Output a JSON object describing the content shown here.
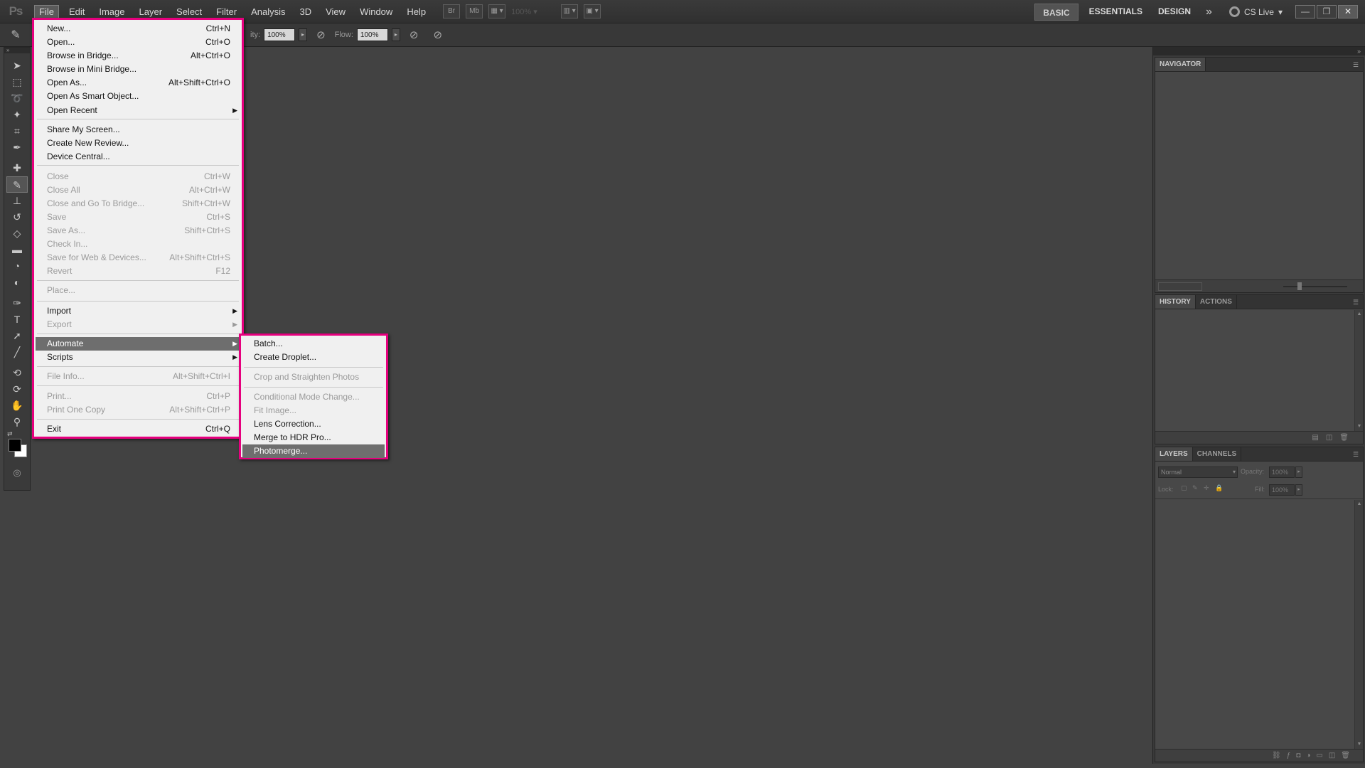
{
  "app": {
    "logo": "Ps"
  },
  "menubar": {
    "items": [
      "File",
      "Edit",
      "Image",
      "Layer",
      "Select",
      "Filter",
      "Analysis",
      "3D",
      "View",
      "Window",
      "Help"
    ],
    "bridge_btn": "Br",
    "minibridge_btn": "Mb",
    "zoom_value": "100%",
    "workspaces": [
      "BASIC",
      "ESSENTIALS",
      "DESIGN"
    ],
    "more": "»",
    "cs_live": "CS Live",
    "window_controls": {
      "minimize": "—",
      "restore": "❐",
      "close": "✕"
    }
  },
  "options": {
    "opacity_label": "ity:",
    "opacity_value": "100%",
    "flow_label": "Flow:",
    "flow_value": "100%"
  },
  "file_menu": {
    "items": [
      {
        "label": "New...",
        "shortcut": "Ctrl+N",
        "enabled": true
      },
      {
        "label": "Open...",
        "shortcut": "Ctrl+O",
        "enabled": true
      },
      {
        "label": "Browse in Bridge...",
        "shortcut": "Alt+Ctrl+O",
        "enabled": true
      },
      {
        "label": "Browse in Mini Bridge...",
        "shortcut": "",
        "enabled": true
      },
      {
        "label": "Open As...",
        "shortcut": "Alt+Shift+Ctrl+O",
        "enabled": true
      },
      {
        "label": "Open As Smart Object...",
        "shortcut": "",
        "enabled": true
      },
      {
        "label": "Open Recent",
        "shortcut": "",
        "enabled": true,
        "submenu": true
      },
      {
        "label": "Share My Screen...",
        "shortcut": "",
        "enabled": true
      },
      {
        "label": "Create New Review...",
        "shortcut": "",
        "enabled": true
      },
      {
        "label": "Device Central...",
        "shortcut": "",
        "enabled": true
      },
      {
        "label": "Close",
        "shortcut": "Ctrl+W",
        "enabled": false
      },
      {
        "label": "Close All",
        "shortcut": "Alt+Ctrl+W",
        "enabled": false
      },
      {
        "label": "Close and Go To Bridge...",
        "shortcut": "Shift+Ctrl+W",
        "enabled": false
      },
      {
        "label": "Save",
        "shortcut": "Ctrl+S",
        "enabled": false
      },
      {
        "label": "Save As...",
        "shortcut": "Shift+Ctrl+S",
        "enabled": false
      },
      {
        "label": "Check In...",
        "shortcut": "",
        "enabled": false
      },
      {
        "label": "Save for Web & Devices...",
        "shortcut": "Alt+Shift+Ctrl+S",
        "enabled": false
      },
      {
        "label": "Revert",
        "shortcut": "F12",
        "enabled": false
      },
      {
        "label": "Place...",
        "shortcut": "",
        "enabled": false
      },
      {
        "label": "Import",
        "shortcut": "",
        "enabled": true,
        "submenu": true
      },
      {
        "label": "Export",
        "shortcut": "",
        "enabled": false,
        "submenu": true
      },
      {
        "label": "Automate",
        "shortcut": "",
        "enabled": true,
        "submenu": true,
        "highlighted": true
      },
      {
        "label": "Scripts",
        "shortcut": "",
        "enabled": true,
        "submenu": true
      },
      {
        "label": "File Info...",
        "shortcut": "Alt+Shift+Ctrl+I",
        "enabled": false
      },
      {
        "label": "Print...",
        "shortcut": "Ctrl+P",
        "enabled": false
      },
      {
        "label": "Print One Copy",
        "shortcut": "Alt+Shift+Ctrl+P",
        "enabled": false
      },
      {
        "label": "Exit",
        "shortcut": "Ctrl+Q",
        "enabled": true
      }
    ]
  },
  "automate_menu": {
    "items": [
      {
        "label": "Batch...",
        "enabled": true
      },
      {
        "label": "Create Droplet...",
        "enabled": true
      },
      {
        "label": "Crop and Straighten Photos",
        "enabled": false
      },
      {
        "label": "Conditional Mode Change...",
        "enabled": false
      },
      {
        "label": "Fit Image...",
        "enabled": false
      },
      {
        "label": "Lens Correction...",
        "enabled": true
      },
      {
        "label": "Merge to HDR Pro...",
        "enabled": true
      },
      {
        "label": "Photomerge...",
        "enabled": true,
        "highlighted": true
      }
    ]
  },
  "panels": {
    "navigator": {
      "tabs": [
        "NAVIGATOR"
      ]
    },
    "history": {
      "tabs": [
        "HISTORY",
        "ACTIONS"
      ]
    },
    "layers": {
      "tabs": [
        "LAYERS",
        "CHANNELS"
      ],
      "blend_mode": "Normal",
      "opacity_label": "Opacity:",
      "opacity_value": "100%",
      "lock_label": "Lock:",
      "fill_label": "Fill:",
      "fill_value": "100%"
    }
  },
  "colors": {
    "highlight_border": "#e6007e",
    "menu_bg": "#f0f0f0",
    "menu_highlight": "#6e6e6e",
    "app_bg": "#424242"
  }
}
